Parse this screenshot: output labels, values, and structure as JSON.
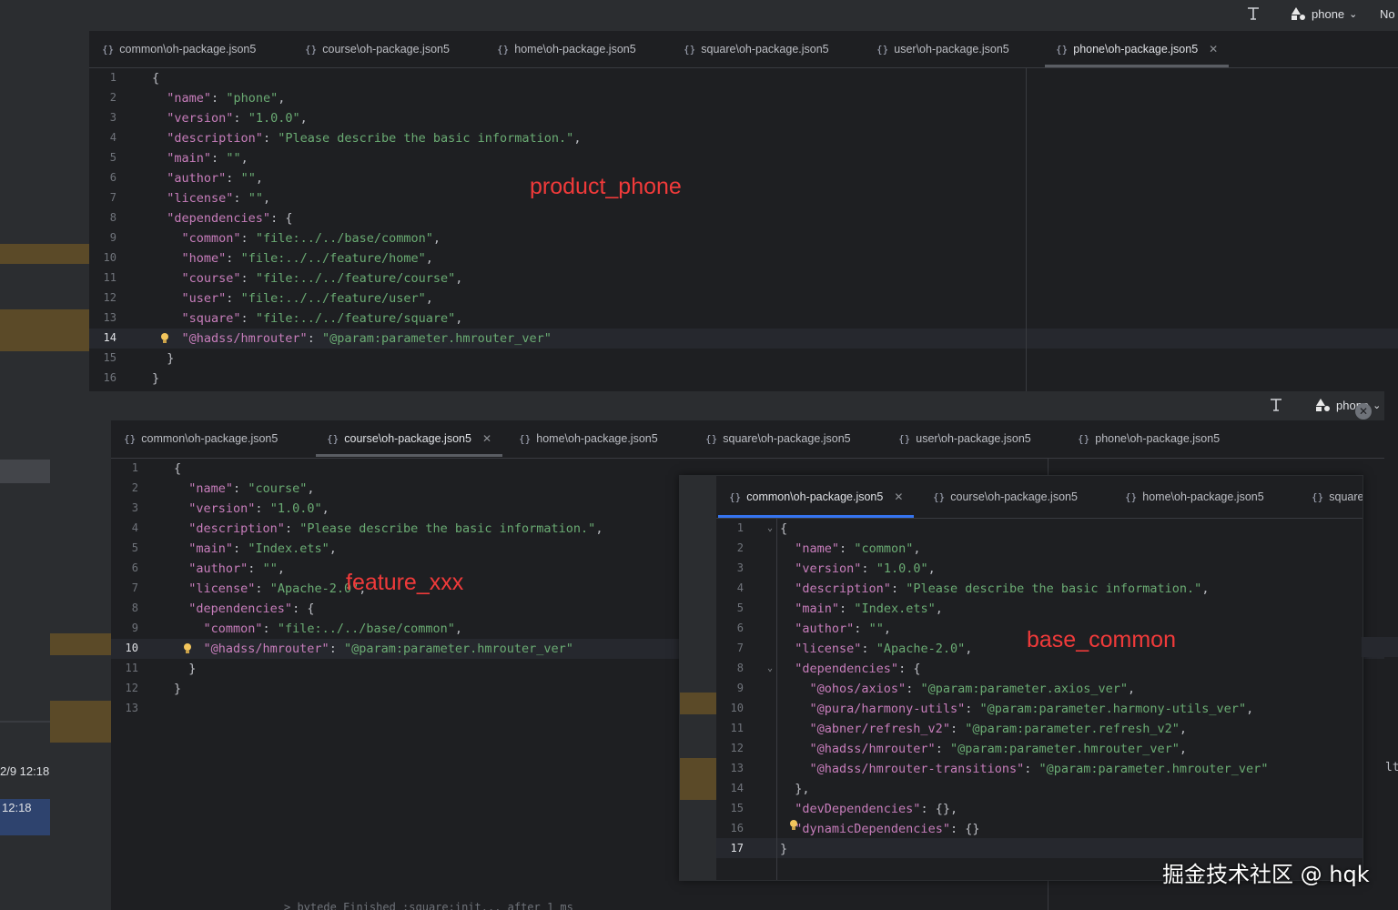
{
  "top": {
    "project": "phone",
    "trailing": "No"
  },
  "panel1": {
    "tabs": [
      {
        "label": "common\\oh-package.json5"
      },
      {
        "label": "course\\oh-package.json5"
      },
      {
        "label": "home\\oh-package.json5"
      },
      {
        "label": "square\\oh-package.json5"
      },
      {
        "label": "user\\oh-package.json5"
      },
      {
        "label": "phone\\oh-package.json5"
      }
    ],
    "label": "product_phone",
    "lines": [
      [
        "{"
      ],
      [
        "  ",
        "\"name\"",
        ": ",
        "\"phone\"",
        ","
      ],
      [
        "  ",
        "\"version\"",
        ": ",
        "\"1.0.0\"",
        ","
      ],
      [
        "  ",
        "\"description\"",
        ": ",
        "\"Please describe the basic information.\"",
        ","
      ],
      [
        "  ",
        "\"main\"",
        ": ",
        "\"\"",
        ","
      ],
      [
        "  ",
        "\"author\"",
        ": ",
        "\"\"",
        ","
      ],
      [
        "  ",
        "\"license\"",
        ": ",
        "\"\"",
        ","
      ],
      [
        "  ",
        "\"dependencies\"",
        ": {"
      ],
      [
        "    ",
        "\"common\"",
        ": ",
        "\"file:../../base/common\"",
        ","
      ],
      [
        "    ",
        "\"home\"",
        ": ",
        "\"file:../../feature/home\"",
        ","
      ],
      [
        "    ",
        "\"course\"",
        ": ",
        "\"file:../../feature/course\"",
        ","
      ],
      [
        "    ",
        "\"user\"",
        ": ",
        "\"file:../../feature/user\"",
        ","
      ],
      [
        "    ",
        "\"square\"",
        ": ",
        "\"file:../../feature/square\"",
        ","
      ],
      [
        "    ",
        "\"@hadss/hmrouter\"",
        ": ",
        "\"@param:parameter.hmrouter_ver\""
      ],
      [
        "  }"
      ],
      [
        "}"
      ]
    ]
  },
  "panel2": {
    "project": "phone",
    "tabs": [
      {
        "label": "common\\oh-package.json5"
      },
      {
        "label": "course\\oh-package.json5"
      },
      {
        "label": "home\\oh-package.json5"
      },
      {
        "label": "square\\oh-package.json5"
      },
      {
        "label": "user\\oh-package.json5"
      },
      {
        "label": "phone\\oh-package.json5"
      }
    ],
    "label": "feature_xxx",
    "lines": [
      [
        "{"
      ],
      [
        "  ",
        "\"name\"",
        ": ",
        "\"course\"",
        ","
      ],
      [
        "  ",
        "\"version\"",
        ": ",
        "\"1.0.0\"",
        ","
      ],
      [
        "  ",
        "\"description\"",
        ": ",
        "\"Please describe the basic information.\"",
        ","
      ],
      [
        "  ",
        "\"main\"",
        ": ",
        "\"Index.ets\"",
        ","
      ],
      [
        "  ",
        "\"author\"",
        ": ",
        "\"\"",
        ","
      ],
      [
        "  ",
        "\"license\"",
        ": ",
        "\"Apache-2.0\"",
        ","
      ],
      [
        "  ",
        "\"dependencies\"",
        ": {"
      ],
      [
        "    ",
        "\"common\"",
        ": ",
        "\"file:../../base/common\"",
        ","
      ],
      [
        "    ",
        "\"@hadss/hmrouter\"",
        ": ",
        "\"@param:parameter.hmrouter_ver\""
      ],
      [
        "  }"
      ],
      [
        "}"
      ],
      [
        ""
      ]
    ]
  },
  "panel3": {
    "tabs": [
      {
        "label": "common\\oh-package.json5"
      },
      {
        "label": "course\\oh-package.json5"
      },
      {
        "label": "home\\oh-package.json5"
      },
      {
        "label": "square"
      }
    ],
    "label": "base_common",
    "lines": [
      [
        "{"
      ],
      [
        "  ",
        "\"name\"",
        ": ",
        "\"common\"",
        ","
      ],
      [
        "  ",
        "\"version\"",
        ": ",
        "\"1.0.0\"",
        ","
      ],
      [
        "  ",
        "\"description\"",
        ": ",
        "\"Please describe the basic information.\"",
        ","
      ],
      [
        "  ",
        "\"main\"",
        ": ",
        "\"Index.ets\"",
        ","
      ],
      [
        "  ",
        "\"author\"",
        ": ",
        "\"\"",
        ","
      ],
      [
        "  ",
        "\"license\"",
        ": ",
        "\"Apache-2.0\"",
        ","
      ],
      [
        "  ",
        "\"dependencies\"",
        ": {"
      ],
      [
        "    ",
        "\"@ohos/axios\"",
        ": ",
        "\"@param:parameter.axios_ver\"",
        ","
      ],
      [
        "    ",
        "\"@pura/harmony-utils\"",
        ": ",
        "\"@param:parameter.harmony-utils_ver\"",
        ","
      ],
      [
        "    ",
        "\"@abner/refresh_v2\"",
        ": ",
        "\"@param:parameter.refresh_v2\"",
        ","
      ],
      [
        "    ",
        "\"@hadss/hmrouter\"",
        ": ",
        "\"@param:parameter.hmrouter_ver\"",
        ","
      ],
      [
        "    ",
        "\"@hadss/hmrouter-transitions\"",
        ": ",
        "\"@param:parameter.hmrouter_ver\""
      ],
      [
        "  },"
      ],
      [
        "  ",
        "\"devDependencies\"",
        ": {},"
      ],
      [
        "  ",
        "\"dynamicDependencies\"",
        ": {}"
      ],
      [
        "}"
      ]
    ]
  },
  "left_strip": {
    "time1": "2/9 12:18",
    "time2": "12:18"
  },
  "right_stub": "lt",
  "watermark": "掘金技术社区 @ hqk",
  "bottom_fragment": "> bytede  Finished :square:init... after 1 ms"
}
